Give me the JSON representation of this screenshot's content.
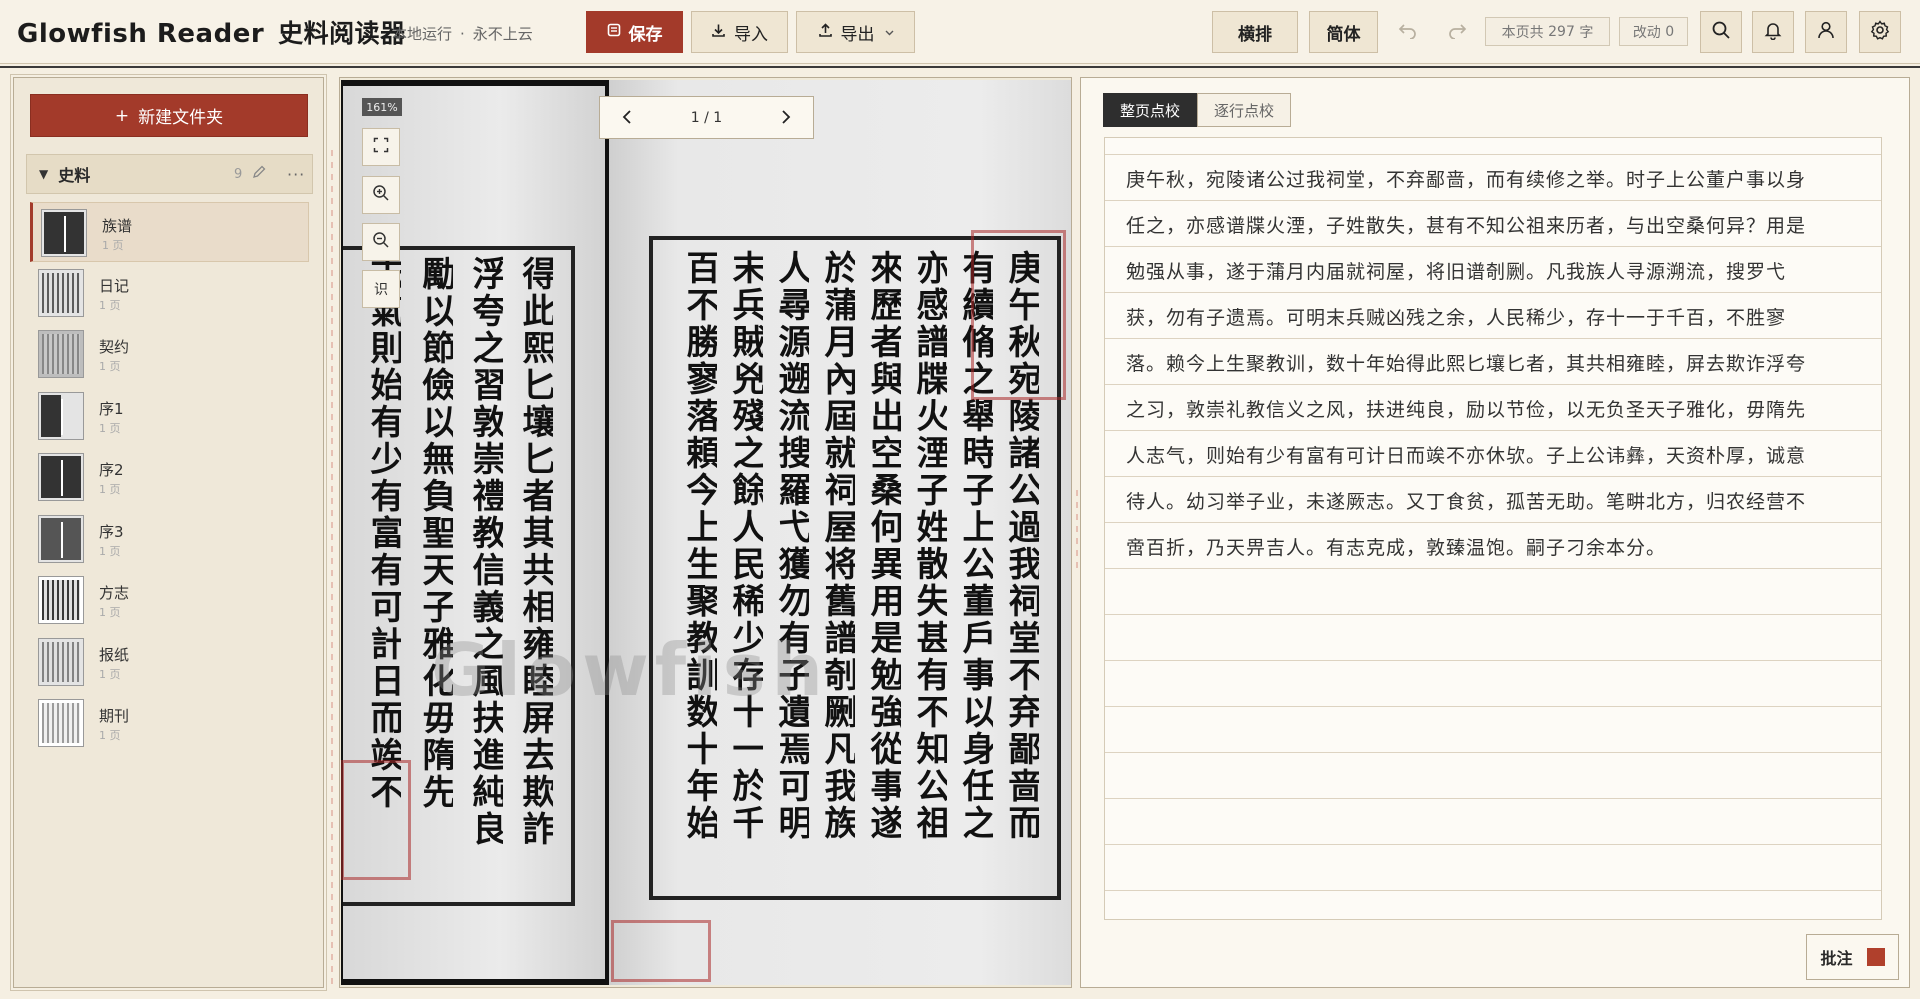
{
  "app": {
    "brand": "Glowfish Reader",
    "brand_cn": "史料阅读器",
    "local_note": "本地运行",
    "separator": "·",
    "cloud_note": "永不上云"
  },
  "toolbar": {
    "save_label": "保存",
    "import_label": "导入",
    "export_label": "导出",
    "layout_label": "横排",
    "script_label": "简体",
    "page_count_label": "本页共",
    "page_count_value": "297",
    "page_count_unit": "字",
    "edit_count_label": "改动",
    "edit_count_value": "0",
    "accent": "#a33a2a"
  },
  "sidebar": {
    "new_folder_label": "新建文件夹",
    "folder": {
      "name": "史料",
      "count": "9"
    },
    "items": [
      {
        "name": "族谱",
        "pages": "1 页",
        "active": true
      },
      {
        "name": "日记",
        "pages": "1 页"
      },
      {
        "name": "契约",
        "pages": "1 页"
      },
      {
        "name": "序1",
        "pages": "1 页"
      },
      {
        "name": "序2",
        "pages": "1 页"
      },
      {
        "name": "序3",
        "pages": "1 页"
      },
      {
        "name": "方志",
        "pages": "1 页"
      },
      {
        "name": "报纸",
        "pages": "1 页"
      },
      {
        "name": "期刊",
        "pages": "1 页"
      }
    ]
  },
  "viewer": {
    "zoom": "161%",
    "ocr_label": "识",
    "page_indicator": "1 / 1",
    "scan_columns_right": [
      "庚午秋宛陵諸公過我祠堂不弃鄙啬而",
      "有續脩之舉時子上公董戶事以身任之",
      "亦感譜牒火湮子姓散失甚有不知公祖",
      "來歷者與出空桑何異用是勉強從事遂",
      "於蒲月內屆就祠屋将舊譜剞劂凡我族",
      "人尋源遡流搜羅弋獲勿有子遺焉可明",
      "末兵賊兇殘之餘人民稀少存十一於千",
      "百不勝寥落頼今上生聚教訓数十年始"
    ],
    "scan_columns_left": [
      "得此熙匕壤匕者其共相雍睦屏去欺詐",
      "浮夸之習敦崇禮教信義之風扶進純良",
      "勵以節儉以無負聖天子雅化毋隋先",
      "志氣則始有少有富有可計日而竢不"
    ],
    "watermark": "Glowfish"
  },
  "proofread": {
    "tab_page": "整页点校",
    "tab_line": "逐行点校",
    "lines": [
      "庚午秋，宛陵诸公过我祠堂，不弃鄙啬，而有续修之举。时子上公董户事以身",
      "任之，亦感谱牒火湮，子姓散失，甚有不知公祖来历者，与出空桑何异？用是",
      "勉强从事，遂于蒲月内届就祠屋，将旧谱剞劂。凡我族人寻源溯流，搜罗弋",
      "获，勿有子遗焉。可明末兵贼凶残之余，人民稀少，存十一于千百，不胜寥",
      "落。赖今上生聚教训，数十年始得此熙匕壤匕者，其共相雍睦，屏去欺诈浮夸",
      "之习，敦崇礼教信义之风，扶进纯良，励以节俭，以无负圣天子雅化，毋隋先",
      "人志气，则始有少有富有可计日而竢不亦休欤。子上公讳彝，天资朴厚，诚意",
      "待人。幼习举子业，未遂厥志。又丁食贫，孤苦无助。笔畊北方，归农经营不",
      "啻百折，乃天畀吉人。有志克成，敦臻温饱。嗣子刁余本分。"
    ],
    "annotate_label": "批注",
    "annotate_color": "#b0402c"
  }
}
